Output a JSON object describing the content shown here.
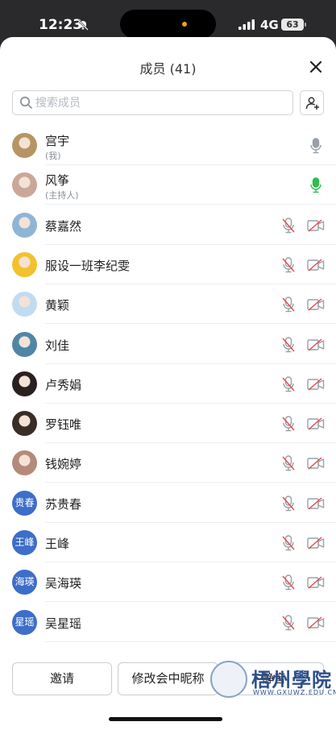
{
  "status_bar": {
    "time": "12:23",
    "network": "4G",
    "battery": "63"
  },
  "sheet": {
    "title": "成员 (41)",
    "search_placeholder": "搜索成员"
  },
  "members": [
    {
      "name": "宫宇",
      "sub": "(我)",
      "avatar": "photo",
      "avatar_color": "#b69563",
      "mic": "on-gray",
      "camera": "none"
    },
    {
      "name": "风筝",
      "sub": "(主持人)",
      "avatar": "photo",
      "avatar_color": "#c9a89a",
      "mic": "on-green",
      "camera": "none"
    },
    {
      "name": "蔡嘉然",
      "avatar": "photo",
      "avatar_color": "#8fb5d6",
      "mic": "muted",
      "camera": "off"
    },
    {
      "name": "服设一班李纪雯",
      "avatar": "photo",
      "avatar_color": "#f2c12e",
      "mic": "muted",
      "camera": "off"
    },
    {
      "name": "黄颖",
      "avatar": "photo",
      "avatar_color": "#bfdcf2",
      "mic": "muted",
      "camera": "off"
    },
    {
      "name": "刘佳",
      "avatar": "photo",
      "avatar_color": "#4f86a6",
      "mic": "muted",
      "camera": "off"
    },
    {
      "name": "卢秀娟",
      "avatar": "photo",
      "avatar_color": "#2a2020",
      "mic": "muted",
      "camera": "off"
    },
    {
      "name": "罗钰唯",
      "avatar": "photo",
      "avatar_color": "#3a2c26",
      "mic": "muted",
      "camera": "off"
    },
    {
      "name": "钱婉婷",
      "avatar": "photo",
      "avatar_color": "#b58a7a",
      "mic": "muted",
      "camera": "off"
    },
    {
      "name": "苏贵春",
      "avatar": "text",
      "avatar_text": "贵春",
      "mic": "muted",
      "camera": "off"
    },
    {
      "name": "王峰",
      "avatar": "text",
      "avatar_text": "王峰",
      "mic": "muted",
      "camera": "off"
    },
    {
      "name": "吴海瑛",
      "avatar": "text",
      "avatar_text": "海瑛",
      "mic": "muted",
      "camera": "off"
    },
    {
      "name": "吴星瑶",
      "avatar": "text",
      "avatar_text": "星瑶",
      "mic": "muted",
      "camera": "off"
    }
  ],
  "buttons": {
    "invite": "邀请",
    "rename": "修改会中昵称",
    "mute": "静音"
  },
  "watermark": {
    "text": "梧州學院",
    "url": "WWW.GXUWZ.EDU.CN"
  },
  "colors": {
    "accent_blue": "#3d6ec9",
    "mic_green": "#2fbd4e",
    "muted_red": "#e5484d"
  }
}
